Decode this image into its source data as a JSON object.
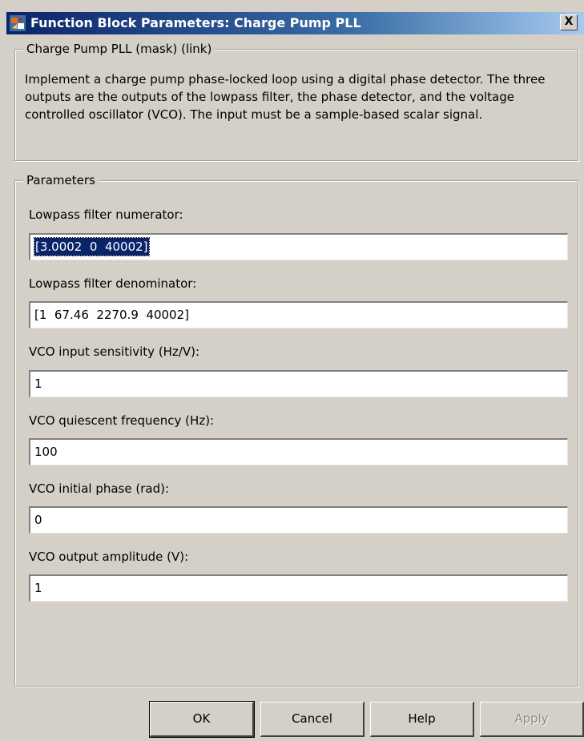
{
  "window": {
    "title": "Function Block Parameters: Charge Pump PLL",
    "close_glyph": "X"
  },
  "mask_group": {
    "legend": "Charge Pump PLL (mask) (link)",
    "description": "Implement a charge pump phase-locked loop using a digital phase detector.  The three outputs are the outputs of the lowpass filter, the phase detector, and the voltage controlled oscillator (VCO).  The input must be a sample-based scalar signal."
  },
  "parameters_group": {
    "legend": "Parameters",
    "fields": [
      {
        "label": "Lowpass filter numerator:",
        "value": "[3.0002  0  40002]"
      },
      {
        "label": "Lowpass filter denominator:",
        "value": "[1  67.46  2270.9  40002]"
      },
      {
        "label": "VCO input sensitivity (Hz/V):",
        "value": "1"
      },
      {
        "label": "VCO quiescent frequency (Hz):",
        "value": "100"
      },
      {
        "label": "VCO initial phase (rad):",
        "value": "0"
      },
      {
        "label": "VCO output amplitude (V):",
        "value": "1"
      }
    ]
  },
  "buttons": {
    "ok": "OK",
    "cancel": "Cancel",
    "help": "Help",
    "apply": "Apply"
  },
  "colors": {
    "titlebar_start": "#0a246a",
    "dialog_bg": "#d4d0c8",
    "selection_bg": "#0a246a"
  },
  "icons": {
    "title_icon": "simulink-block-icon"
  }
}
